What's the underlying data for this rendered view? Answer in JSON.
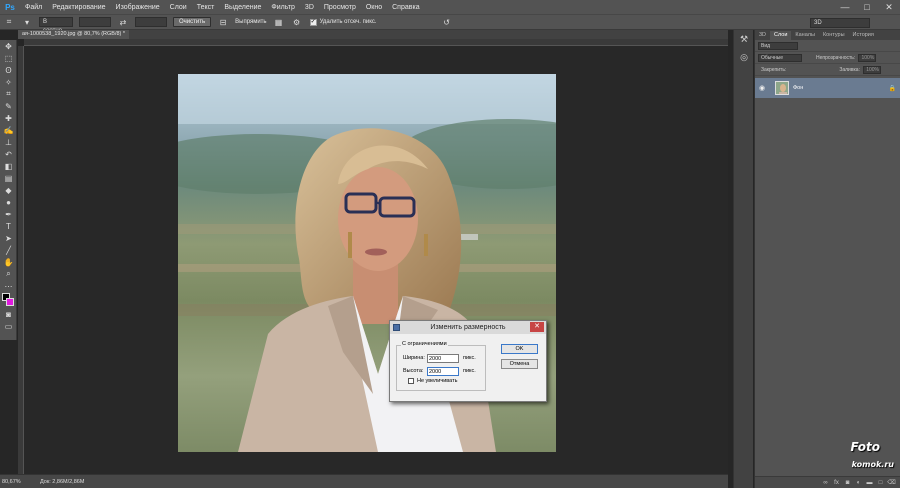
{
  "app": {
    "logo": "Ps",
    "menu": [
      "Файл",
      "Редактирование",
      "Изображение",
      "Слои",
      "Текст",
      "Выделение",
      "Фильтр",
      "3D",
      "Просмотр",
      "Окно",
      "Справка"
    ],
    "window_controls": [
      "—",
      "□",
      "✕"
    ]
  },
  "options_bar": {
    "ratio_select": "В соотно...",
    "clear_button": "Очистить",
    "straighten_label": "Выпрямить",
    "delete_cropped_label": "Удалить отсеч. пикс.",
    "workspace_select": "3D"
  },
  "document": {
    "tab_title": "ая-1000538_1920.jpg @ 80,7% (RGB/8) *",
    "zoom": "80,67%",
    "doc_size": "Док: 2,86M/2,86M"
  },
  "layers_panel": {
    "tabs": [
      "3D",
      "Слои",
      "Каналы",
      "Контуры",
      "История"
    ],
    "active_tab": "Слои",
    "filter_label": "Вид",
    "blend_mode": "Обычные",
    "opacity_label": "Непрозрачность:",
    "opacity_value": "100%",
    "lock_label": "Закрепить:",
    "fill_label": "Заливка:",
    "fill_value": "100%",
    "layer_name": "Фон"
  },
  "dialog": {
    "title": "Изменить размерность",
    "constraints_label": "С ограничениями",
    "width_label": "Ширина:",
    "width_value": "2000",
    "width_unit": "пикс.",
    "height_label": "Высота:",
    "height_value": "2000",
    "height_unit": "пикс.",
    "no_enlarge_label": "Не увеличивать",
    "ok_label": "OK",
    "cancel_label": "Отмена"
  },
  "watermark": {
    "line1": "Foto",
    "line2": "komok.ru"
  },
  "colors": {
    "foreground": "#000000",
    "background": "#e21ae0",
    "selected_layer": "#6a7b91",
    "close_button": "#c74444"
  }
}
